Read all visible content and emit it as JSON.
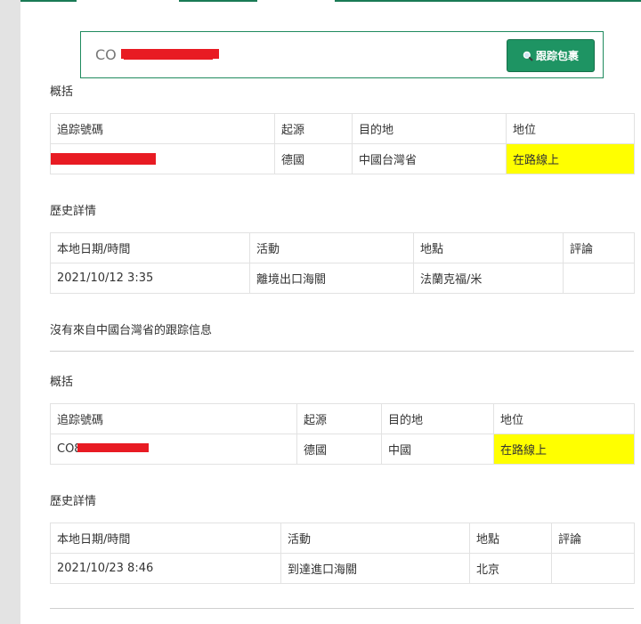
{
  "search": {
    "value": "CO",
    "button_label": "跟踪包裹",
    "button_icon": "magnifier-icon"
  },
  "shipments": [
    {
      "summary_title": "概括",
      "summary_headers": [
        "追踪號碼",
        "起源",
        "目的地",
        "地位"
      ],
      "summary_row": {
        "tracking": "",
        "origin": "德國",
        "destination": "中國台灣省",
        "status": "在路線上"
      },
      "history_title": "歷史詳情",
      "history_headers": [
        "本地日期/時間",
        "活動",
        "地點",
        "評論"
      ],
      "history_rows": [
        {
          "datetime": "2021/10/12 3:35",
          "activity": "離境出口海關",
          "location": "法蘭克福/米",
          "comment": ""
        }
      ],
      "note": "沒有來自中國台灣省的跟踪信息"
    },
    {
      "summary_title": "概括",
      "summary_headers": [
        "追踪號碼",
        "起源",
        "目的地",
        "地位"
      ],
      "summary_row": {
        "tracking": "CO8",
        "origin": "德國",
        "destination": "中國",
        "status": "在路線上"
      },
      "history_title": "歷史詳情",
      "history_headers": [
        "本地日期/時間",
        "活動",
        "地點",
        "評論"
      ],
      "history_rows": [
        {
          "datetime": "2021/10/23 8:46",
          "activity": "到達進口海關",
          "location": "北京",
          "comment": ""
        }
      ]
    }
  ],
  "colors": {
    "accent": "#1e9463",
    "status_highlight": "#ffff00",
    "redaction": "#e81b23"
  }
}
